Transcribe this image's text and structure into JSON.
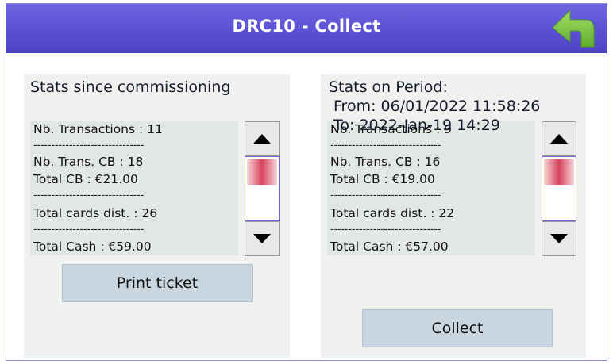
{
  "header": {
    "title": "DRC10 - Collect",
    "back_icon": "back-arrow-icon"
  },
  "colors": {
    "header": "#5a4fd2",
    "back_arrow": "#7cc242",
    "panel": "#eef1ee",
    "button": "#c9d6df"
  },
  "left_panel": {
    "title": "Stats since commissioning",
    "stats": {
      "transactions": "Nb. Transactions : 11",
      "sep": "-------------------------------",
      "trans_cb": "Nb. Trans. CB : 18",
      "total_cb": "Total CB : €21.00",
      "cards_dist": "Total cards dist. : 26",
      "total_cash": "Total Cash : €59.00"
    },
    "button": "Print ticket"
  },
  "right_panel": {
    "title": "Stats on Period:",
    "from": "From: 06/01/2022 11:58:26",
    "to": "To: 2022-Jan-19 14:29",
    "stats": {
      "transactions": "Nb. Transactions : 9",
      "sep": "-------------------------------",
      "trans_cb": "Nb. Trans. CB : 16",
      "total_cb": "Total CB : €19.00",
      "cards_dist": "Total cards dist. : 22",
      "total_cash": "Total Cash : €57.00"
    },
    "button": "Collect"
  }
}
